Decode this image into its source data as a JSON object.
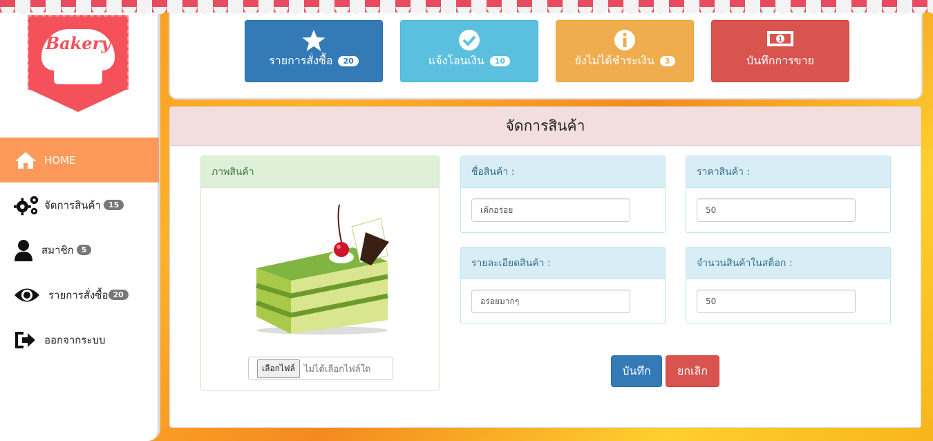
{
  "logo": {
    "text": "Bakery"
  },
  "sidebar": {
    "items": [
      {
        "label": "HOME",
        "icon": "home-icon",
        "badge": ""
      },
      {
        "label": "จัดการสินค้า",
        "icon": "gears-icon",
        "badge": "15"
      },
      {
        "label": "สมาชิก",
        "icon": "user-icon",
        "badge": "5"
      },
      {
        "label": "รายการสั่งซื้อ",
        "icon": "eye-icon",
        "badge": "20"
      },
      {
        "label": "ออกจากระบบ",
        "icon": "logout-icon",
        "badge": ""
      }
    ]
  },
  "stats": [
    {
      "label": "รายการสั่งซื้อ",
      "badge": "20",
      "icon": "star-icon",
      "color": "#337ab7"
    },
    {
      "label": "แจ้งโอนเงิน",
      "badge": "10",
      "icon": "check-circle-icon",
      "color": "#5bc0de"
    },
    {
      "label": "ยังไม่ได้ชำระเงิน",
      "badge": "3",
      "icon": "info-icon",
      "color": "#f0ad4e"
    },
    {
      "label": "บันทึกการขาย",
      "badge": "",
      "icon": "money-icon",
      "color": "#d9534f"
    }
  ],
  "main": {
    "title": "จัดการสินค้า",
    "image_panel": {
      "title": "ภาพสินค้า",
      "file_button": "เลือกไฟล์",
      "file_status": "ไม่ได้เลือกไฟล์ใด"
    },
    "fields": {
      "name": {
        "label": "ชื่อสินค้า :",
        "value": "เค้กอร่อย"
      },
      "price": {
        "label": "ราคาสินค้า :",
        "value": "50"
      },
      "detail": {
        "label": "รายละเอียดสินค้า :",
        "value": "อร่อยมากๆ"
      },
      "stock": {
        "label": "จำนวนสินค้าในสต็อก :",
        "value": "50"
      }
    },
    "save_label": "บันทึก",
    "cancel_label": "ยกเลิก"
  }
}
